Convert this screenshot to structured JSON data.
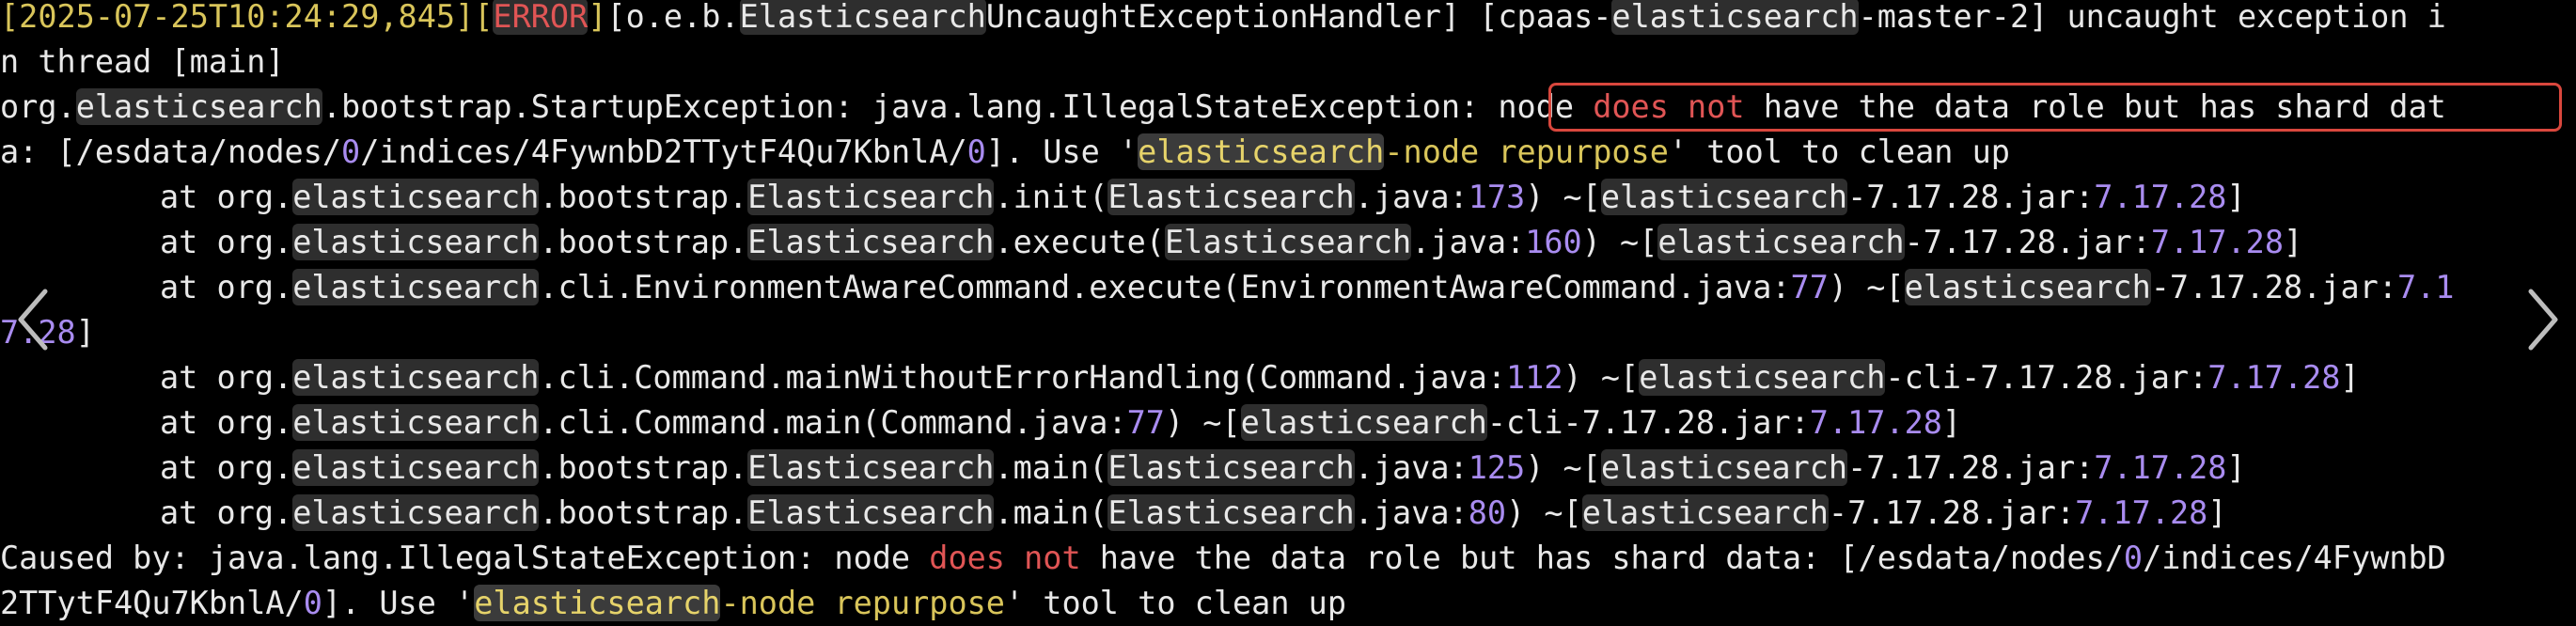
{
  "log": {
    "l1": {
      "ts": "2025-07-25T10:24:29,845",
      "level": "ERROR",
      "logger_a": "o.e.b.",
      "logger_b": "Elasticsearch",
      "logger_c": "UncaughtExceptionHandler",
      "thread_a": "cpaas-",
      "thread_b": "elasticsearch",
      "thread_c": "-master-2",
      "msg": " uncaught exception i"
    },
    "l2": {
      "text": "n thread [main]"
    },
    "l3": {
      "a": "org.",
      "b": "elasticsearch",
      "c": ".bootstrap.StartupException: java.lang.IllegalStateException: ",
      "d": "node ",
      "e": "does not",
      "f": " have the data role but has shard dat"
    },
    "l4": {
      "a": "a: [/esdata/nodes/",
      "b": "0",
      "c": "/indices/4FywnbD2TTytF4Qu7KbnlA/",
      "d": "0",
      "e": "]. Use '",
      "f": "elasticsearch",
      "g": "-node repurpose",
      "h": "' tool to clean up"
    },
    "l5": {
      "a": "at org.",
      "b": "elasticsearch",
      "c": ".bootstrap.",
      "d": "Elasticsearch",
      "e": ".init(",
      "f": "Elasticsearch",
      "g": ".java:",
      "h": "173",
      "i": ") ~[",
      "j": "elasticsearch",
      "k": "-7.17.28.jar:",
      "l": "7.17.28",
      "m": "]"
    },
    "l6": {
      "a": "at org.",
      "b": "elasticsearch",
      "c": ".bootstrap.",
      "d": "Elasticsearch",
      "e": ".execute(",
      "f": "Elasticsearch",
      "g": ".java:",
      "h": "160",
      "i": ") ~[",
      "j": "elasticsearch",
      "k": "-7.17.28.jar:",
      "l": "7.17.28",
      "m": "]"
    },
    "l7": {
      "a": "at org.",
      "b": "elasticsearch",
      "c": ".cli.EnvironmentAwareCommand.execute(EnvironmentAwareCommand.java:",
      "d": "77",
      "e": ") ~[",
      "f": "elasticsearch",
      "g": "-7.17.28.jar:",
      "h": "7.1"
    },
    "l8": {
      "a": "7.28",
      "b": "]"
    },
    "l9": {
      "a": "at org.",
      "b": "elasticsearch",
      "c": ".cli.Command.mainWithoutErrorHandling(Command.java:",
      "d": "112",
      "e": ") ~[",
      "f": "elasticsearch",
      "g": "-cli-7.17.28.jar:",
      "h": "7.17.28",
      "i": "]"
    },
    "l10": {
      "a": "at org.",
      "b": "elasticsearch",
      "c": ".cli.Command.main(Command.java:",
      "d": "77",
      "e": ") ~[",
      "f": "elasticsearch",
      "g": "-cli-7.17.28.jar:",
      "h": "7.17.28",
      "i": "]"
    },
    "l11": {
      "a": "at org.",
      "b": "elasticsearch",
      "c": ".bootstrap.",
      "d": "Elasticsearch",
      "e": ".main(",
      "f": "Elasticsearch",
      "g": ".java:",
      "h": "125",
      "i": ") ~[",
      "j": "elasticsearch",
      "k": "-7.17.28.jar:",
      "l": "7.17.28",
      "m": "]"
    },
    "l12": {
      "a": "at org.",
      "b": "elasticsearch",
      "c": ".bootstrap.",
      "d": "Elasticsearch",
      "e": ".main(",
      "f": "Elasticsearch",
      "g": ".java:",
      "h": "80",
      "i": ") ~[",
      "j": "elasticsearch",
      "k": "-7.17.28.jar:",
      "l": "7.17.28",
      "m": "]"
    },
    "l13": {
      "a": "Caused by: java.lang.IllegalStateException: node ",
      "b": "does not",
      "c": " have the data role but has shard data: [/esdata/nodes/",
      "d": "0",
      "e": "/indices/4FywnbD"
    },
    "l14": {
      "a": "2TTytF4Qu7KbnlA/",
      "b": "0",
      "c": "]. Use '",
      "d": "elasticsearch",
      "e": "-node repurpose",
      "f": "' tool to clean up"
    }
  },
  "icons": {
    "prev": "chevron-left-icon",
    "next": "chevron-right-icon"
  },
  "colors": {
    "background": "#000000",
    "text": "#e8e8e8",
    "yellow": "#d9c55a",
    "red": "#e05555",
    "purple": "#a98cf0",
    "highlight_box": "#d9473d"
  }
}
